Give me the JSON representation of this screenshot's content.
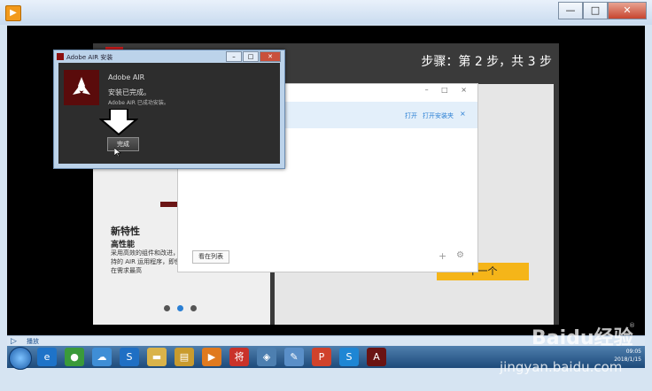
{
  "player": {
    "title": "",
    "controls": {
      "minimize": "—",
      "restore": "□",
      "close": "✕"
    },
    "status_text": "播放"
  },
  "slide": {
    "step_label": "步骤：第 2 步，共 3 步",
    "feature_title": "新特性",
    "feature_sub": "高性能",
    "feature_desc": "采用高效的组件和改进，支持的 AIR 运用程序，即使是在需求最高",
    "next_button": "下一个"
  },
  "installer": {
    "open_link": "打开",
    "open_folder_link": "打开安装夹",
    "close_x": "×",
    "list_button": "看在列表",
    "window_controls": "– □ ×"
  },
  "air_dialog": {
    "title": "Adobe AIR 安装",
    "product_name": "Adobe AIR",
    "status": "安装已完成。",
    "installed_text": "Adobe AIR 已成功安装。",
    "finish_button": "完成"
  },
  "taskbar": {
    "icons": [
      {
        "name": "ie-icon",
        "glyph": "e",
        "color": "#1e73c8"
      },
      {
        "name": "chrome-icon",
        "glyph": "●",
        "color": "#3a9a3a"
      },
      {
        "name": "cloud-icon",
        "glyph": "☁",
        "color": "#3f8ed6"
      },
      {
        "name": "sogou-icon",
        "glyph": "S",
        "color": "#1f6fc4"
      },
      {
        "name": "folder-icon",
        "glyph": "▬",
        "color": "#d9b34a"
      },
      {
        "name": "explorer-icon",
        "glyph": "▤",
        "color": "#c99b2e"
      },
      {
        "name": "media-icon",
        "glyph": "▶",
        "color": "#e07a1f"
      },
      {
        "name": "app-red-icon",
        "glyph": "将",
        "color": "#c9322a"
      },
      {
        "name": "network-icon",
        "glyph": "◈",
        "color": "#4d7fb0"
      },
      {
        "name": "paint-icon",
        "glyph": "✎",
        "color": "#5a8fc8"
      },
      {
        "name": "p-app-icon",
        "glyph": "P",
        "color": "#d0422b"
      },
      {
        "name": "skype-icon",
        "glyph": "S",
        "color": "#1e86d4"
      },
      {
        "name": "adobe-air-icon",
        "glyph": "A",
        "color": "#6a1313"
      }
    ],
    "clock_time": "09:05",
    "clock_date": "2018/1/15"
  },
  "watermark": {
    "brand": "Baidu经验",
    "url": "jingyan.baidu.com",
    "reg": "®"
  },
  "colors": {
    "accent": "#2a7fd4",
    "next_button": "#f5b519",
    "adobe_red": "#5a0b0b"
  }
}
